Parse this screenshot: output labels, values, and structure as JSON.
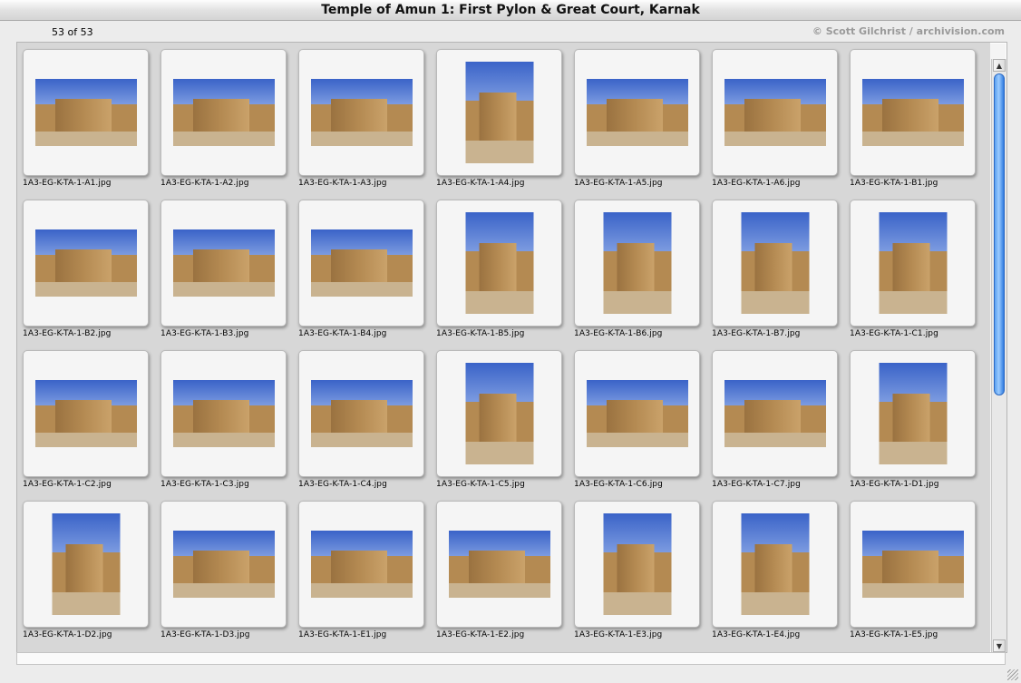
{
  "window": {
    "title": "Temple of Amun 1: First Pylon & Great Court, Karnak"
  },
  "header": {
    "counter": "53 of 53",
    "copyright": "© Scott Gilchrist / archivision.com"
  },
  "scrollbar": {
    "position_fraction": 0.0,
    "visible_fraction": 0.57,
    "up_icon": "▲",
    "down_icon": "▼"
  },
  "colors": {
    "sky": "#3a63c8",
    "stone": "#b48a52",
    "sand": "#c9b390",
    "accent": "#3a87ee"
  },
  "files": [
    {
      "name": "1A3-EG-K-TA-1-A1.jpg",
      "orient": "land"
    },
    {
      "name": "1A3-EG-K-TA-1-A2.jpg",
      "orient": "land"
    },
    {
      "name": "1A3-EG-K-TA-1-A3.jpg",
      "orient": "land"
    },
    {
      "name": "1A3-EG-K-TA-1-A4.jpg",
      "orient": "port"
    },
    {
      "name": "1A3-EG-K-TA-1-A5.jpg",
      "orient": "land"
    },
    {
      "name": "1A3-EG-K-TA-1-A6.jpg",
      "orient": "land"
    },
    {
      "name": "1A3-EG-K-TA-1-B1.jpg",
      "orient": "land"
    },
    {
      "name": "1A3-EG-K-TA-1-B2.jpg",
      "orient": "land"
    },
    {
      "name": "1A3-EG-K-TA-1-B3.jpg",
      "orient": "land"
    },
    {
      "name": "1A3-EG-K-TA-1-B4.jpg",
      "orient": "land"
    },
    {
      "name": "1A3-EG-K-TA-1-B5.jpg",
      "orient": "port"
    },
    {
      "name": "1A3-EG-K-TA-1-B6.jpg",
      "orient": "port"
    },
    {
      "name": "1A3-EG-K-TA-1-B7.jpg",
      "orient": "port"
    },
    {
      "name": "1A3-EG-K-TA-1-C1.jpg",
      "orient": "port"
    },
    {
      "name": "1A3-EG-K-TA-1-C2.jpg",
      "orient": "land"
    },
    {
      "name": "1A3-EG-K-TA-1-C3.jpg",
      "orient": "land"
    },
    {
      "name": "1A3-EG-K-TA-1-C4.jpg",
      "orient": "land"
    },
    {
      "name": "1A3-EG-K-TA-1-C5.jpg",
      "orient": "port"
    },
    {
      "name": "1A3-EG-K-TA-1-C6.jpg",
      "orient": "land"
    },
    {
      "name": "1A3-EG-K-TA-1-C7.jpg",
      "orient": "land"
    },
    {
      "name": "1A3-EG-K-TA-1-D1.jpg",
      "orient": "port"
    },
    {
      "name": "1A3-EG-K-TA-1-D2.jpg",
      "orient": "port"
    },
    {
      "name": "1A3-EG-K-TA-1-D3.jpg",
      "orient": "land"
    },
    {
      "name": "1A3-EG-K-TA-1-E1.jpg",
      "orient": "land"
    },
    {
      "name": "1A3-EG-K-TA-1-E2.jpg",
      "orient": "land"
    },
    {
      "name": "1A3-EG-K-TA-1-E3.jpg",
      "orient": "port"
    },
    {
      "name": "1A3-EG-K-TA-1-E4.jpg",
      "orient": "port"
    },
    {
      "name": "1A3-EG-K-TA-1-E5.jpg",
      "orient": "land"
    }
  ]
}
